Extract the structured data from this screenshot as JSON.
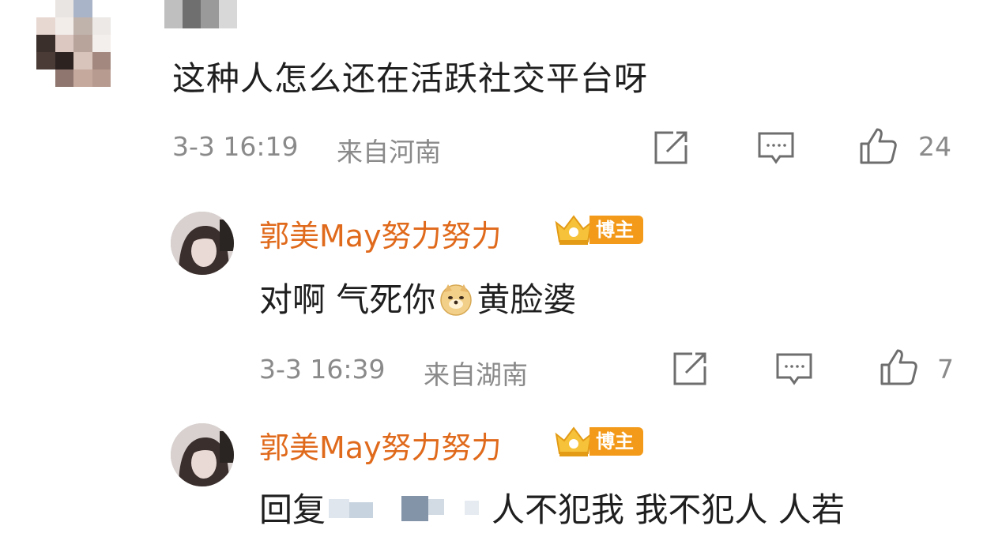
{
  "comment": {
    "text": "这种人怎么还在活跃社交平台呀",
    "time": "3-3 16:19",
    "location": "来自河南",
    "likes": "24"
  },
  "replies": [
    {
      "username": "郭美May努力努力",
      "badge": "博主",
      "text_before_emoji": "对啊 气死你",
      "emoji": "doge-emoji",
      "text_after_emoji": "黄脸婆",
      "time": "3-3 16:39",
      "location": "来自湖南",
      "likes": "7"
    },
    {
      "username": "郭美May努力努力",
      "badge": "博主",
      "reply_prefix": "回复",
      "text": "人不犯我 我不犯人 人若"
    }
  ],
  "icons": [
    "share-icon",
    "comment-icon",
    "like-icon",
    "crown-icon"
  ],
  "colors": {
    "username": "#e06a1c",
    "badge": "#f39a1a",
    "meta": "#8a8a8a"
  }
}
